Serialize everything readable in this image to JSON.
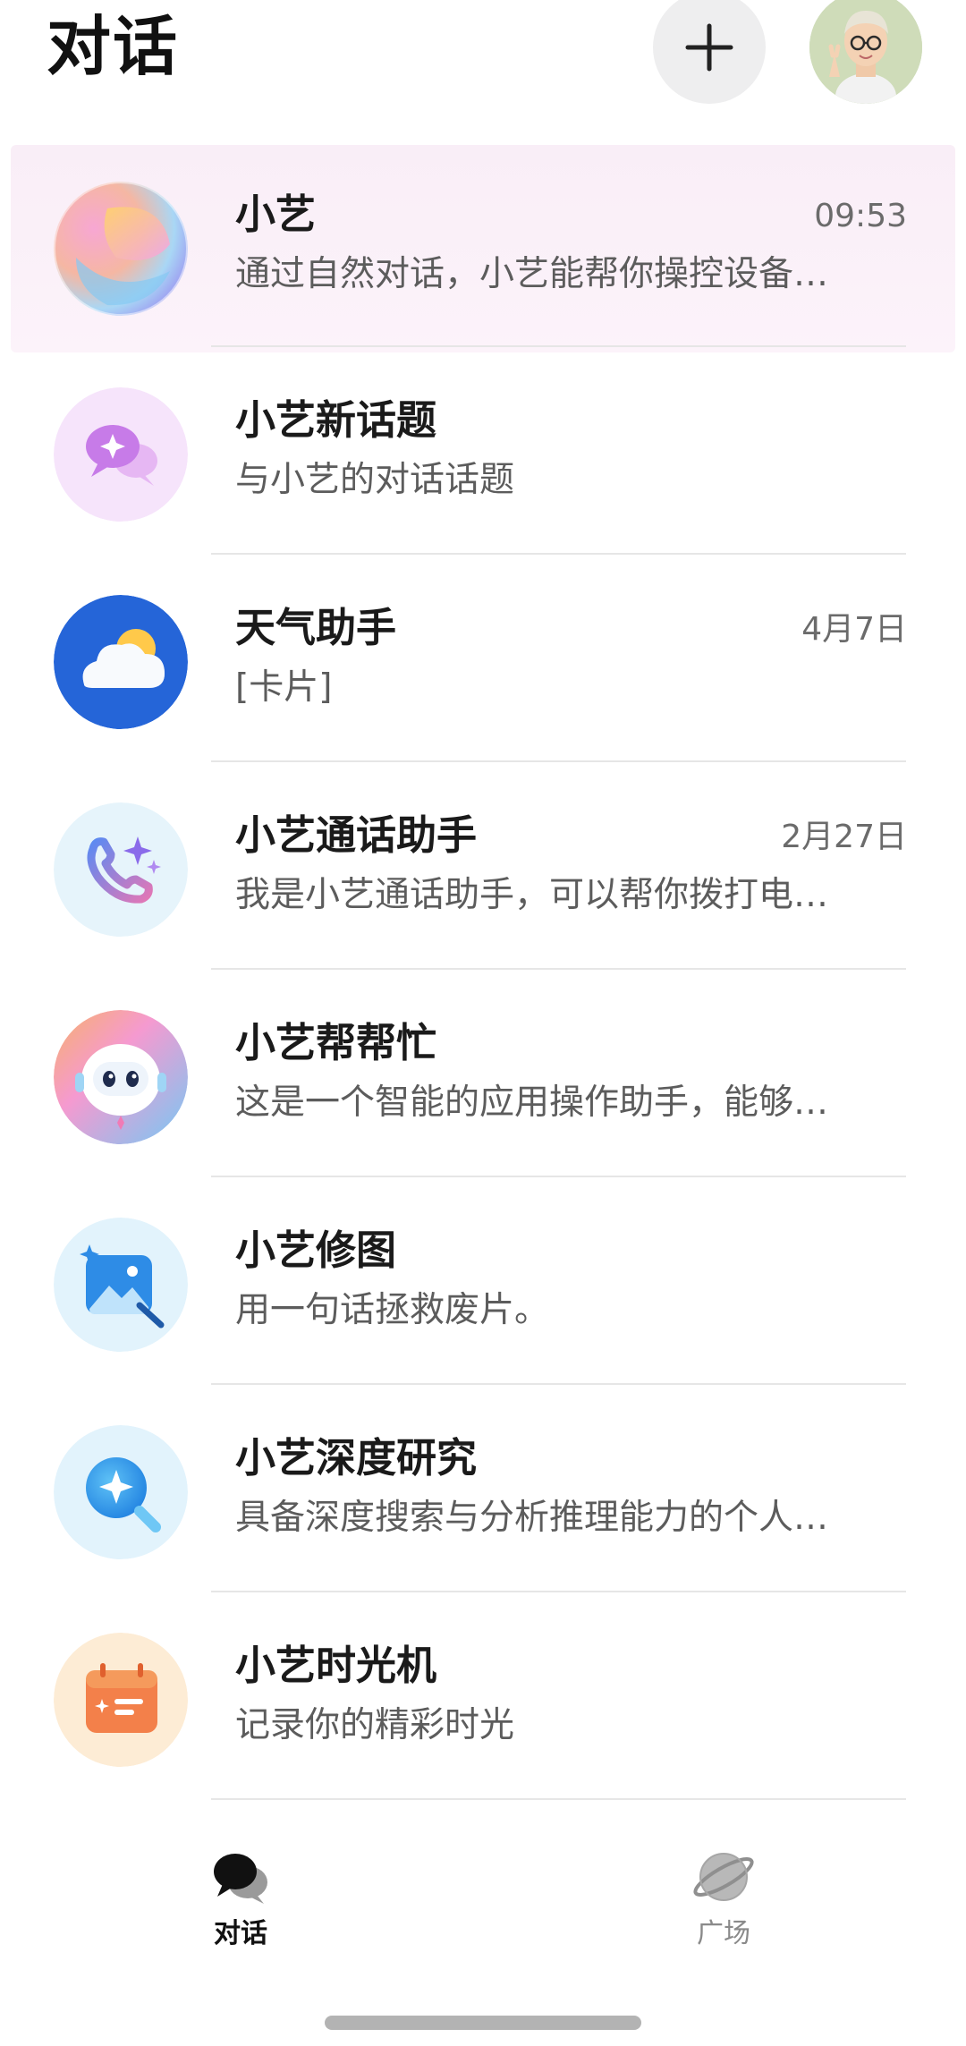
{
  "header": {
    "title": "对话",
    "add_icon": "plus-icon",
    "avatar_icon": "user-avatar"
  },
  "chats": [
    {
      "name": "小艺",
      "time": "09:53",
      "preview": "通过自然对话，小艺能帮你操控设备…",
      "icon": "xiaoyi-orb-icon",
      "highlighted": true
    },
    {
      "name": "小艺新话题",
      "time": "",
      "preview": "与小艺的对话话题",
      "icon": "chat-bubble-sparkle-icon"
    },
    {
      "name": "天气助手",
      "time": "4月7日",
      "preview": "[卡片]",
      "icon": "weather-cloud-sun-icon"
    },
    {
      "name": "小艺通话助手",
      "time": "2月27日",
      "preview": "我是小艺通话助手，可以帮你拨打电…",
      "icon": "phone-sparkle-icon"
    },
    {
      "name": "小艺帮帮忙",
      "time": "",
      "preview": "这是一个智能的应用操作助手，能够…",
      "icon": "robot-mascot-icon"
    },
    {
      "name": "小艺修图",
      "time": "",
      "preview": "用一句话拯救废片。",
      "icon": "photo-edit-icon"
    },
    {
      "name": "小艺深度研究",
      "time": "",
      "preview": "具备深度搜索与分析推理能力的个人…",
      "icon": "magnifier-sparkle-icon"
    },
    {
      "name": "小艺时光机",
      "time": "",
      "preview": "记录你的精彩时光",
      "icon": "calendar-icon"
    }
  ],
  "bottom_nav": {
    "items": [
      {
        "label": "对话",
        "icon": "chat-bubbles-icon",
        "active": true
      },
      {
        "label": "广场",
        "icon": "planet-icon",
        "active": false
      }
    ]
  },
  "colors": {
    "highlight_bg": "#f9eef7",
    "weather_blue": "#2565d8",
    "text_primary": "#1a1a1a",
    "text_secondary": "#5c5c5c",
    "time_text": "#6b6b6b"
  }
}
